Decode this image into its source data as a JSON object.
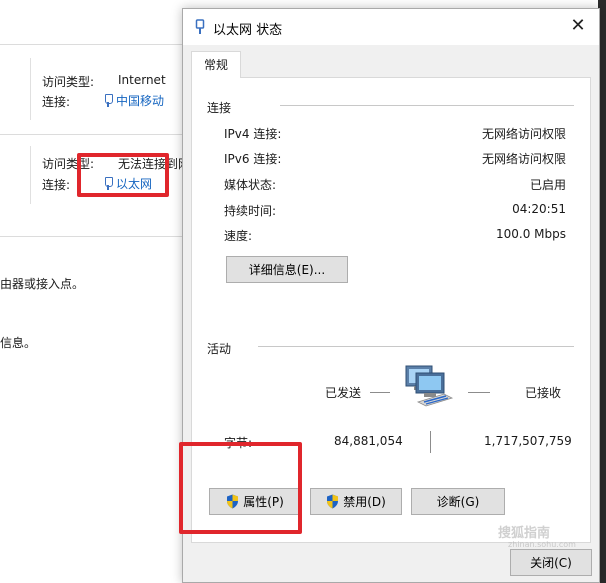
{
  "background": {
    "network1": {
      "access_type_label": "访问类型:",
      "access_type_value": "Internet",
      "connection_label": "连接:",
      "connection_value": "中国移动"
    },
    "network2": {
      "access_type_label": "访问类型:",
      "access_type_value": "无法连接到网",
      "connection_label": "连接:",
      "connection_value": "以太网"
    },
    "text1": "由器或接入点。",
    "text2": "信息。"
  },
  "dialog": {
    "title": "以太网 状态",
    "close_glyph": "✕",
    "tab_label": "常规",
    "connection_group": {
      "label": "连接",
      "rows": [
        {
          "label": "IPv4 连接:",
          "value": "无网络访问权限"
        },
        {
          "label": "IPv6 连接:",
          "value": "无网络访问权限"
        },
        {
          "label": "媒体状态:",
          "value": "已启用"
        },
        {
          "label": "持续时间:",
          "value": "04:20:51"
        },
        {
          "label": "速度:",
          "value": "100.0 Mbps"
        }
      ],
      "details_button": "详细信息(E)..."
    },
    "activity_group": {
      "label": "活动",
      "sent_label": "已发送",
      "received_label": "已接收",
      "bytes_label": "字节:",
      "bytes_sent": "84,881,054",
      "bytes_received": "1,717,507,759"
    },
    "buttons": {
      "properties": "属性(P)",
      "disable": "禁用(D)",
      "diagnose": "诊断(G)",
      "close": "关闭(C)"
    }
  },
  "watermark": {
    "main": "搜狐指南",
    "sub": "zhinan.sohu.com"
  },
  "colors": {
    "accent_link": "#1565c0",
    "highlight_red": "#e0262c",
    "shield_blue": "#1e63c4",
    "shield_yellow": "#f2c318"
  }
}
